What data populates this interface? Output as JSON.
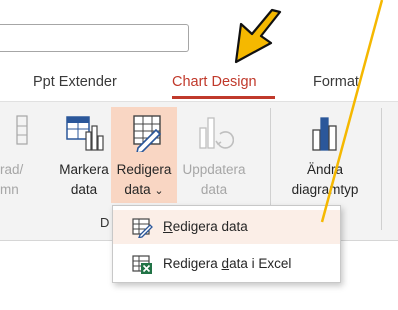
{
  "tabs": [
    {
      "label": "Ppt Extender"
    },
    {
      "label": "Chart Design",
      "active": true
    },
    {
      "label": "Format"
    }
  ],
  "ribbon": {
    "buttons": [
      {
        "line1": "rad/",
        "line2": "mn",
        "disabled": true
      },
      {
        "line1": "Markera",
        "line2": "data"
      },
      {
        "line1": "Redigera",
        "line2": "data",
        "has_dropdown": true,
        "highlighted": true
      },
      {
        "line1": "Uppdatera",
        "line2": "data",
        "disabled": true
      },
      {
        "line1": "Ändra",
        "line2": "diagramtyp"
      }
    ],
    "group_label": "D",
    "dropdown_arrow": "⌄"
  },
  "dropdown": {
    "items": [
      {
        "label_u": "R",
        "label_rest": "edigera data",
        "icon": "edit-table-icon",
        "hover": true
      },
      {
        "label_pre": "Redigera ",
        "label_u": "d",
        "label_rest": "ata i Excel",
        "icon": "excel-table-icon"
      }
    ]
  },
  "colors": {
    "accent": "#c0392b",
    "highlight": "#f9d6c3",
    "menu_hover": "#fbeee7",
    "annotation": "#f5b800"
  },
  "annotation": {
    "icon": "cursor-arrow-annotation-icon"
  }
}
